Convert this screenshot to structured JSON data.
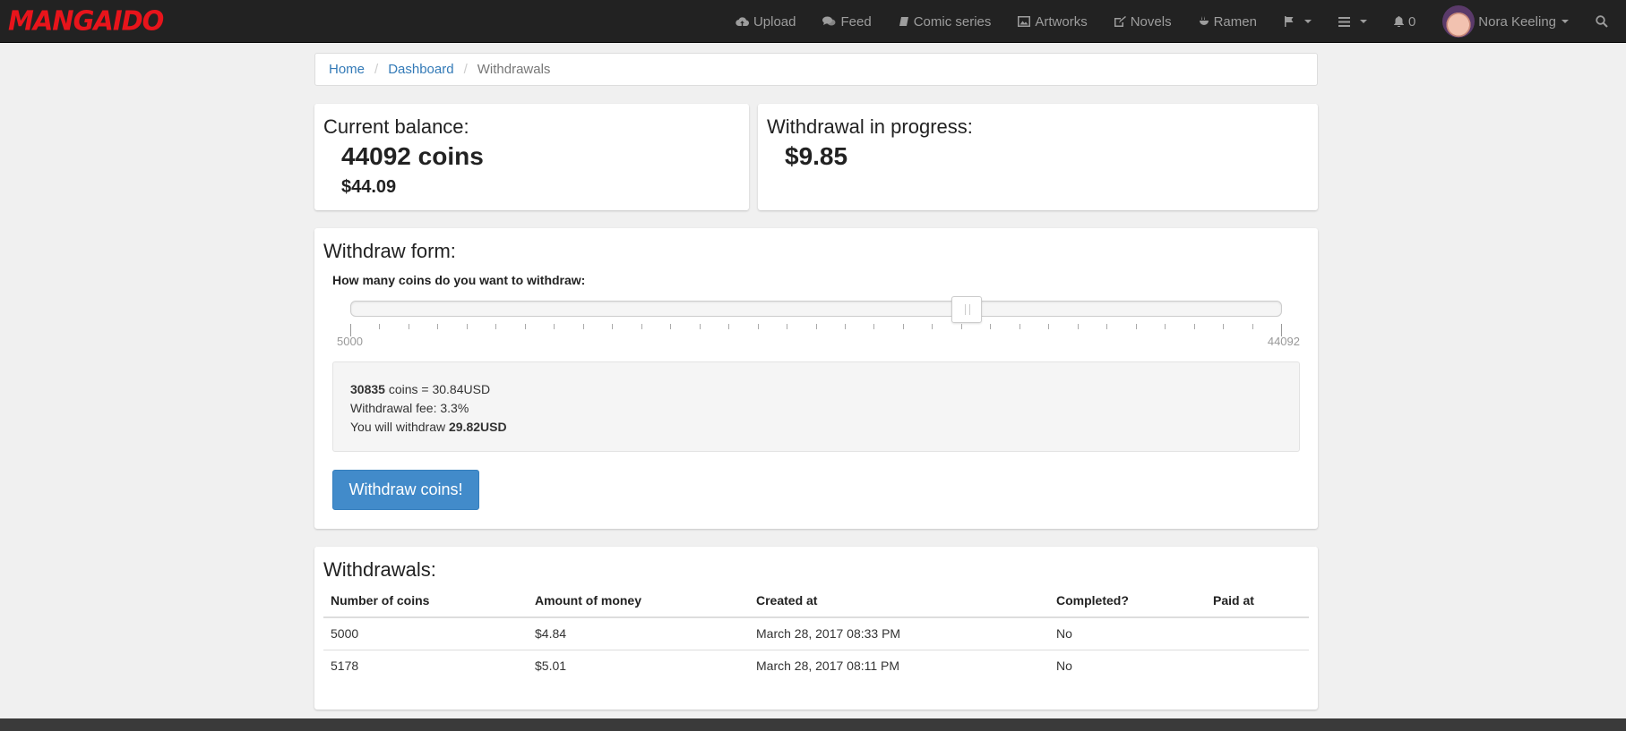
{
  "brand": "MANGAIDO",
  "nav": {
    "upload": "Upload",
    "feed": "Feed",
    "comic_series": "Comic series",
    "artworks": "Artworks",
    "novels": "Novels",
    "ramen": "Ramen",
    "notifications": "0",
    "user_name": "Nora Keeling"
  },
  "breadcrumb": {
    "home": "Home",
    "dashboard": "Dashboard",
    "current": "Withdrawals"
  },
  "balance": {
    "title": "Current balance:",
    "coins": "44092 coins",
    "usd": "$44.09"
  },
  "progress": {
    "title": "Withdrawal in progress:",
    "amount": "$9.85"
  },
  "form": {
    "title": "Withdraw form:",
    "label": "How many coins do you want to withdraw:",
    "slider": {
      "min": 5000,
      "max": 44092,
      "value": 30835,
      "min_label": "5000",
      "max_label": "44092"
    },
    "summary": {
      "coins": "30835",
      "coins_suffix": " coins = 30.84USD",
      "fee": "Withdrawal fee: 3.3%",
      "withdraw_prefix": "You will withdraw ",
      "withdraw_amount": "29.82USD"
    },
    "button": "Withdraw coins!"
  },
  "withdrawals": {
    "title": "Withdrawals:",
    "columns": [
      "Number of coins",
      "Amount of money",
      "Created at",
      "Completed?",
      "Paid at"
    ],
    "rows": [
      [
        "5000",
        "$4.84",
        "March 28, 2017 08:33 PM",
        "No",
        ""
      ],
      [
        "5178",
        "$5.01",
        "March 28, 2017 08:11 PM",
        "No",
        ""
      ]
    ]
  },
  "colors": {
    "brand": "#e8141b",
    "primary": "#428bca",
    "navbar": "#222222"
  }
}
